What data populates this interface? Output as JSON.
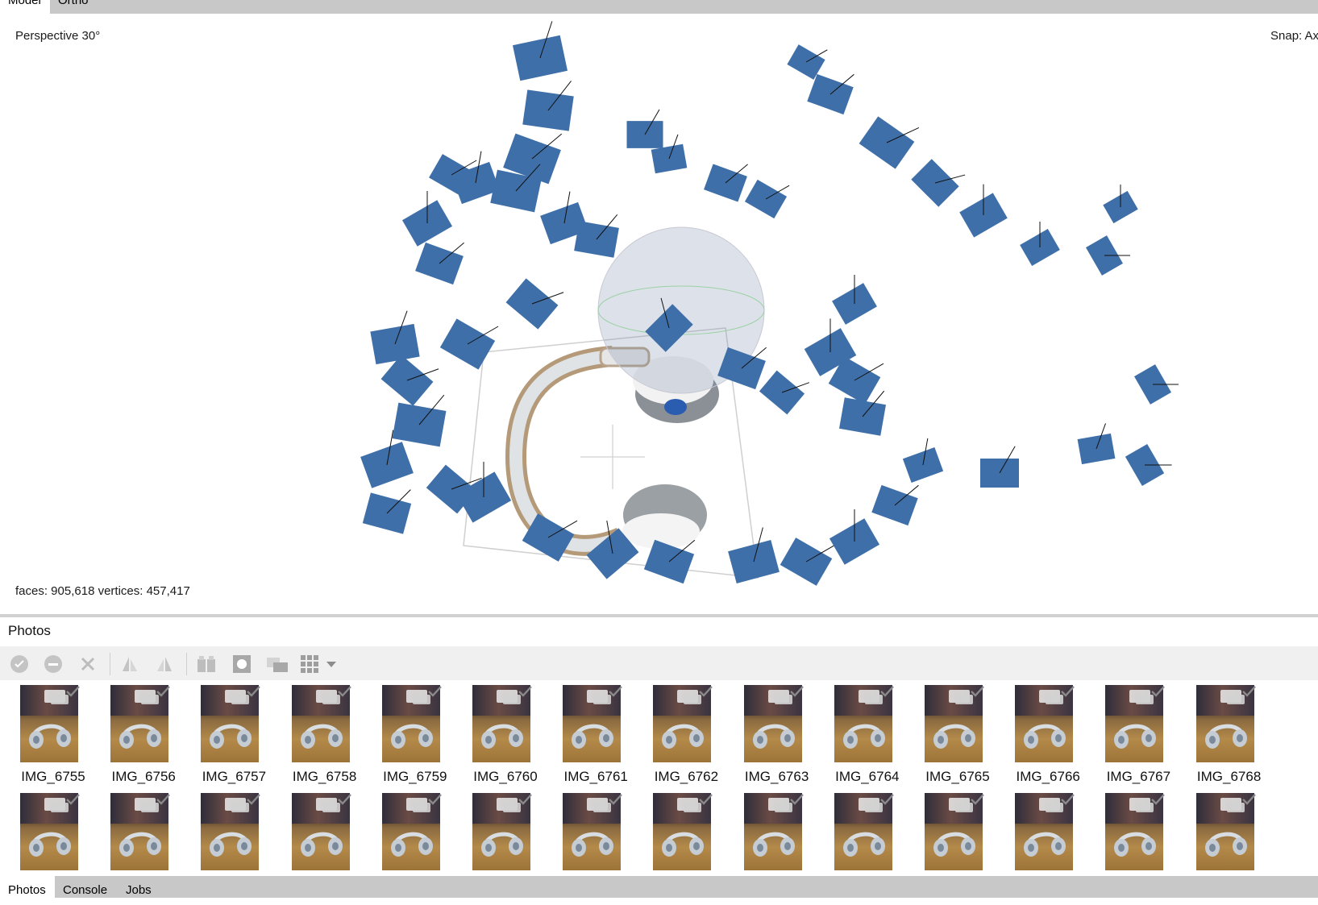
{
  "top_tabs": [
    {
      "label": "Model",
      "active": true
    },
    {
      "label": "Ortho",
      "active": false
    }
  ],
  "viewport": {
    "projection": "Perspective 30°",
    "snap": "Snap: Axis",
    "stats": "faces: 905,618 vertices: 457,417",
    "camera_color": "#3f6fa8"
  },
  "photos_panel": {
    "title": "Photos",
    "toolbar_icons": [
      "enable-cameras-icon",
      "disable-cameras-icon",
      "remove-cameras-icon",
      "rotate-left-icon",
      "rotate-right-icon",
      "estimate-quality-icon",
      "mask-icon",
      "reset-view-icon",
      "view-mode-icon",
      "dropdown-arrow-icon"
    ],
    "row1": [
      "IMG_6755",
      "IMG_6756",
      "IMG_6757",
      "IMG_6758",
      "IMG_6759",
      "IMG_6760",
      "IMG_6761",
      "IMG_6762",
      "IMG_6763",
      "IMG_6764",
      "IMG_6765",
      "IMG_6766",
      "IMG_6767",
      "IMG_6768"
    ],
    "row2_count": 14
  },
  "bottom_tabs": [
    {
      "label": "Photos",
      "active": true
    },
    {
      "label": "Console",
      "active": false
    },
    {
      "label": "Jobs",
      "active": false
    }
  ]
}
